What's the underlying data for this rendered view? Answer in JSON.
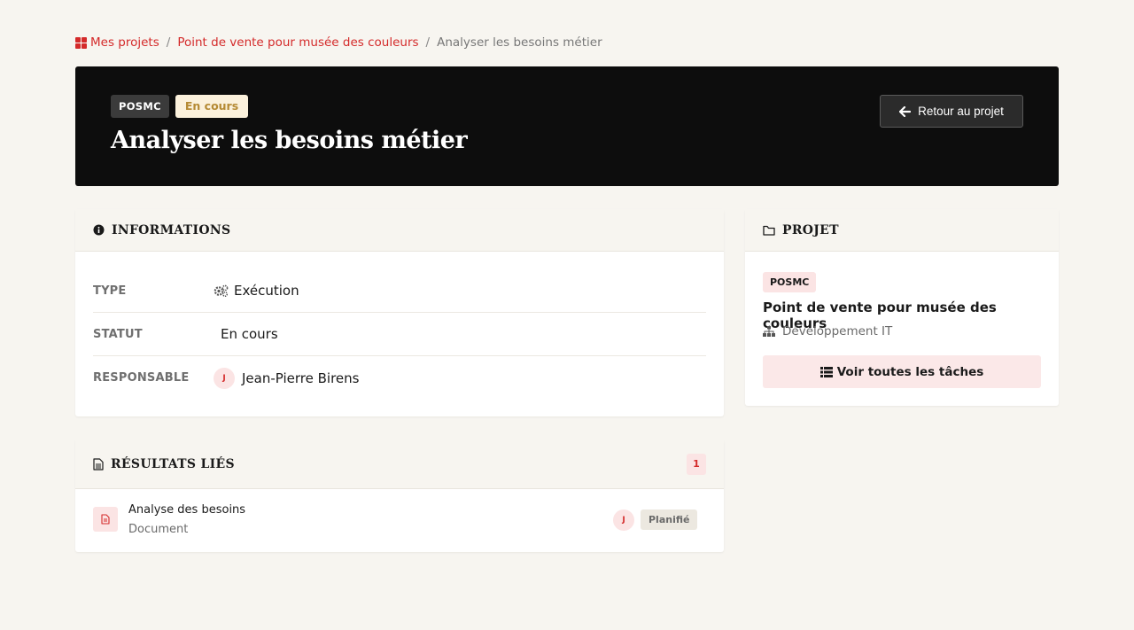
{
  "breadcrumb": {
    "home": "Mes projets",
    "project": "Point de vente pour musée des couleurs",
    "current": "Analyser les besoins métier"
  },
  "hero": {
    "code": "POSMC",
    "status": "En cours",
    "title": "Analyser les besoins métier",
    "back_label": "Retour au projet"
  },
  "info": {
    "title": "INFORMATIONS",
    "rows": [
      {
        "label": "TYPE",
        "value": "Exécution",
        "icon": "cogs-icon"
      },
      {
        "label": "STATUT",
        "value": "En cours"
      },
      {
        "label": "RESPONSABLE",
        "value": "Jean-Pierre Birens",
        "avatar": "J"
      }
    ]
  },
  "project": {
    "title": "PROJET",
    "code": "POSMC",
    "name": "Point de vente pour musée des couleurs",
    "department": "Développement IT",
    "all_tasks_label": "Voir toutes les tâches"
  },
  "results": {
    "title": "RÉSULTATS LIÉS",
    "count": "1",
    "items": [
      {
        "name": "Analyse des besoins",
        "type": "Document",
        "avatar": "J",
        "status": "Planifié"
      }
    ]
  },
  "colors": {
    "accent": "#d42a2a",
    "hero_bg": "#0d0d0d",
    "status_bg": "#fbf1dc",
    "status_fg": "#b58a34"
  }
}
